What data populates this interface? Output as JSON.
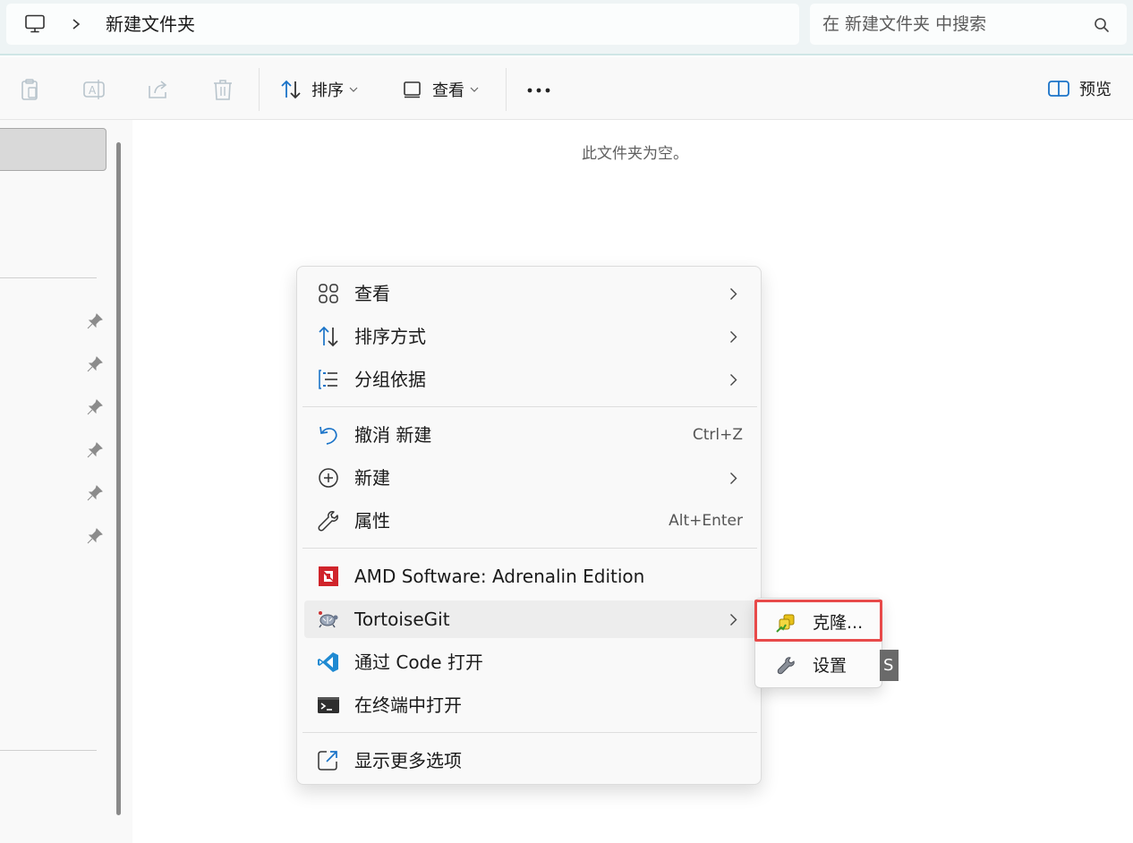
{
  "address_bar": {
    "icon": "computer-icon",
    "breadcrumb": "新建文件夹"
  },
  "search": {
    "placeholder": "在 新建文件夹 中搜索"
  },
  "toolbar": {
    "sort_label": "排序",
    "view_label": "查看",
    "preview_label": "预览"
  },
  "content": {
    "empty_message": "此文件夹为空。"
  },
  "context_menu": {
    "items": [
      {
        "label": "查看",
        "icon": "grid-view-icon",
        "submenu": true
      },
      {
        "label": "排序方式",
        "icon": "sort-icon",
        "submenu": true
      },
      {
        "label": "分组依据",
        "icon": "group-list-icon",
        "submenu": true
      },
      {
        "label": "撤消 新建",
        "icon": "undo-icon",
        "shortcut": "Ctrl+Z"
      },
      {
        "label": "新建",
        "icon": "add-circle-icon",
        "submenu": true
      },
      {
        "label": "属性",
        "icon": "wrench-icon",
        "shortcut": "Alt+Enter"
      },
      {
        "label": "AMD Software: Adrenalin Edition",
        "icon": "amd-logo-icon"
      },
      {
        "label": "TortoiseGit",
        "icon": "tortoisegit-icon",
        "submenu": true,
        "hovered": true
      },
      {
        "label": "通过 Code 打开",
        "icon": "vscode-icon"
      },
      {
        "label": "在终端中打开",
        "icon": "terminal-icon"
      },
      {
        "label": "显示更多选项",
        "icon": "show-more-icon"
      }
    ]
  },
  "tortoisegit_submenu": {
    "items": [
      {
        "label": "克隆...",
        "icon": "clone-icon",
        "highlighted": true
      },
      {
        "label": "设置",
        "icon": "settings-wrench-icon"
      }
    ]
  },
  "edge_tag": "S",
  "colors": {
    "accent_blue": "#1a73c8",
    "highlight_red": "#e84a4a",
    "amd_red": "#d0242b"
  }
}
